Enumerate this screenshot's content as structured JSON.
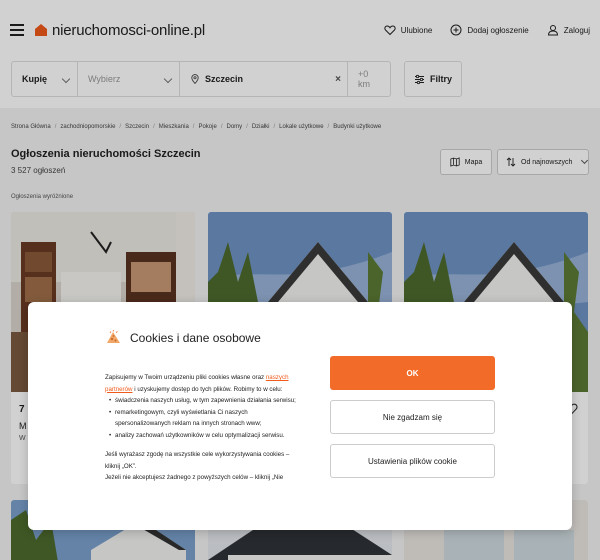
{
  "header": {
    "logo_text": "nieruchomosci-online.pl",
    "favorites_label": "Ulubione",
    "add_listing_label": "Dodaj ogłoszenie",
    "login_label": "Zaloguj"
  },
  "search": {
    "transaction_value": "Kupię",
    "type_placeholder": "Wybierz",
    "city_value": "Szczecin",
    "radius_value": "+0 km",
    "filters_label": "Filtry"
  },
  "breadcrumbs": [
    "Strona Główna",
    "zachodniopomorskie",
    "Szczecin",
    "Mieszkania",
    "Pokoje",
    "Domy",
    "Działki",
    "Lokale użytkowe",
    "Budynki użytkowe"
  ],
  "page": {
    "title": "Ogłoszenia nieruchomości Szczecin",
    "count": "3 527 ogłoszeń",
    "map_label": "Mapa",
    "sort_label": "Od najnowszych",
    "featured_label": "Ogłoszenia wyróżnione"
  },
  "cards": [
    {
      "price": "7",
      "subtitle": "M",
      "location": "W"
    },
    {
      "price": "",
      "subtitle": "",
      "location": ""
    },
    {
      "price": "",
      "subtitle": "",
      "location": ""
    }
  ],
  "cookie_dialog": {
    "title": "Cookies i dane osobowe",
    "intro_before_link": "Zapisujemy w Twoim urządzeniu pliki cookies własne oraz ",
    "link_text": "naszych partnerów",
    "intro_after_link": " i uzyskujemy dostęp do tych plików. Robimy to w celu:",
    "bullets": [
      "świadczenia naszych usług, w tym zapewnienia działania serwisu;",
      "remarketingowym, czyli wyświetlania Ci naszych spersonalizowanych reklam na innych stronach www;",
      "analizy zachowań użytkowników w celu optymalizacji serwisu."
    ],
    "consent_text": "Jeśli wyrażasz zgodę na wszystkie cele wykorzystywania cookies – kliknij „OK”.",
    "reject_text": "Jeżeli nie akceptujesz żadnego z powyższych celów – kliknij „Nie",
    "ok_label": "OK",
    "reject_label": "Nie zgadzam się",
    "settings_label": "Ustawienia plików cookie"
  },
  "colors": {
    "accent": "#f26b29",
    "logo": "#f05a1a",
    "link": "#f05a1a"
  }
}
